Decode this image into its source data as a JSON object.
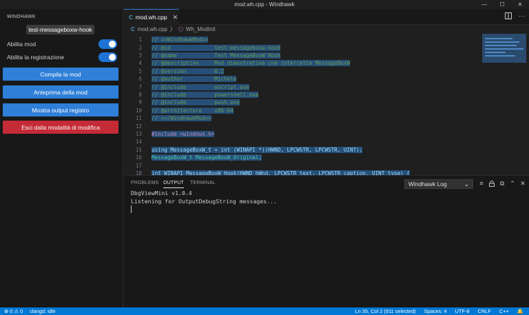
{
  "window": {
    "title": "mod.wh.cpp - Windhawk",
    "minimize": "—",
    "maximize": "☐",
    "close": "✕"
  },
  "sidebar": {
    "header": "WINDHAWK",
    "mod_id": "test-messageboxw-hook",
    "toggles": [
      {
        "label": "Abilita mod",
        "on": true
      },
      {
        "label": "Abilita la registrazione",
        "on": true
      }
    ],
    "buttons": {
      "compile": "Compila la mod",
      "preview": "Anteprima della mod",
      "show_log": "Mostra output registro",
      "exit": "Esci dalla modalità di modifica"
    }
  },
  "editor": {
    "tab_icon": "C",
    "tab_label": "mod.wh.cpp",
    "tab_close": "✕",
    "breadcrumb": {
      "file": "mod.wh.cpp",
      "separator": "〉",
      "symbol": "Wh_ModInit"
    },
    "lines": [
      {
        "n": "1",
        "text": "// ==WindhawkMod=="
      },
      {
        "n": "2",
        "text": "// @id              test-messageboxw-hook"
      },
      {
        "n": "3",
        "text": "// @name            Test MessageBoxW Hook"
      },
      {
        "n": "4",
        "text": "// @description     Mod dimostrativa che intercetta MessageBoxW"
      },
      {
        "n": "5",
        "text": "// @version         0.2"
      },
      {
        "n": "6",
        "text": "// @author          Michele"
      },
      {
        "n": "7",
        "text": "// @include         wscript.exe"
      },
      {
        "n": "8",
        "text": "// @include         powershell.exe"
      },
      {
        "n": "9",
        "text": "// @include         pwsh.exe"
      },
      {
        "n": "10",
        "text": "// @architecture    x86-64"
      },
      {
        "n": "11",
        "text": "// ==/WindhawkMod=="
      },
      {
        "n": "12",
        "text": ""
      },
      {
        "n": "13",
        "text": "#include <windows.h>"
      },
      {
        "n": "14",
        "text": ""
      },
      {
        "n": "15",
        "text": "using MessageBoxW_t = int (WINAPI *)(HWND, LPCWSTR, LPCWSTR, UINT);"
      },
      {
        "n": "16",
        "text": "MessageBoxW_t MessageBoxW_Original;"
      },
      {
        "n": "17",
        "text": ""
      },
      {
        "n": "18",
        "text": "int WINAPI MessageBoxW_Hook(HWND hWnd, LPCWSTR text, LPCWSTR caption, UINT type) {"
      }
    ]
  },
  "panel": {
    "tabs": [
      "PROBLEMS",
      "OUTPUT",
      "TERMINAL"
    ],
    "active_tab": "OUTPUT",
    "log_source": "Windhawk Log",
    "log_chevron": "⌄",
    "output_lines": "DbgViewMini v1.0.4\nListening for OutputDebugString messages..."
  },
  "statusbar": {
    "errors": "⊗ 0 ⚠ 0",
    "clangd": "clangd: idle",
    "position": "Ln 35, Col 2 (911 selected)",
    "spaces": "Spaces: 4",
    "encoding": "UTF-8",
    "eol": "CRLF",
    "language": "C++",
    "bell": "🔔"
  },
  "colors": {
    "accent": "#0078d4",
    "button": "#2f7fd8",
    "danger": "#c42b36",
    "selection": "#264f78"
  }
}
